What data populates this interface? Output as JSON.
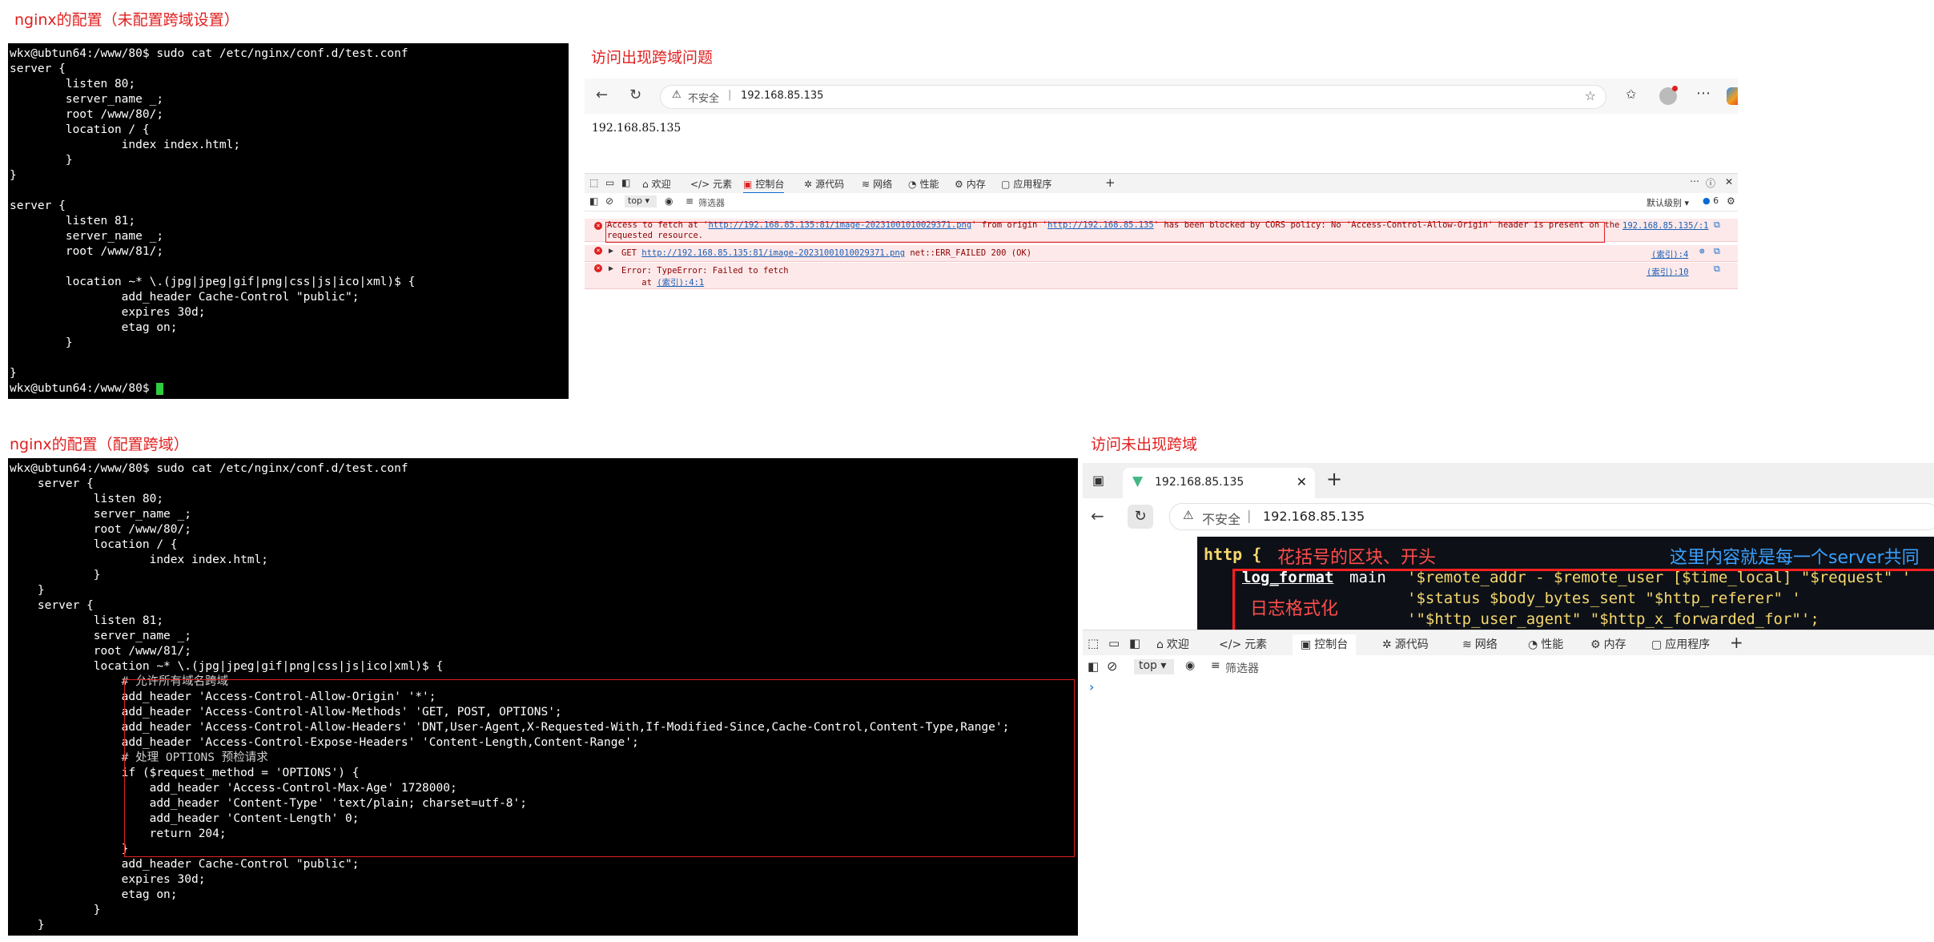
{
  "top_left": {
    "heading": "nginx的配置（未配置跨域设置）",
    "terminal_lines": [
      "wkx@ubtun64:/www/80$ sudo cat /etc/nginx/conf.d/test.conf",
      "server {",
      "        listen 80;",
      "        server_name _;",
      "        root /www/80/;",
      "        location / {",
      "                index index.html;",
      "        }",
      "}",
      "",
      "server {",
      "        listen 81;",
      "        server_name _;",
      "        root /www/81/;",
      "",
      "        location ~* \\.(jpg|jpeg|gif|png|css|js|ico|xml)$ {",
      "                add_header Cache-Control \"public\";",
      "                expires 30d;",
      "                etag on;",
      "        }",
      "",
      "}"
    ],
    "prompt": "wkx@ubtun64:/www/80$ "
  },
  "top_right": {
    "heading": "访问出现跨域问题",
    "insecure_label": "不安全",
    "separator": "|",
    "url": "192.168.85.135",
    "page_text": "192.168.85.135",
    "devtools_tabs": [
      "欢迎",
      "元素",
      "控制台",
      "源代码",
      "网络",
      "性能",
      "内存",
      "应用程序"
    ],
    "context_select": "top",
    "filter_placeholder": "筛选器",
    "level_select": "默认级别",
    "issue_count": "6",
    "errors": {
      "cors": {
        "prefix": "Access to fetch at '",
        "url1": "http://192.168.85.135:81/image-20231001010029371.png",
        "mid": "' from origin '",
        "url2": "http://192.168.85.135",
        "suffix": "' has been blocked by CORS policy: No 'Access-Control-Allow-Origin' header is present on the",
        "line2": "requested resource.",
        "source": "192.168.85.135/:1"
      },
      "get": {
        "prefix": "GET ",
        "url": "http://192.168.85.135:81/image-20231001010029371.png",
        "suffix": " net::ERR_FAILED 200 (OK)",
        "source": "(索引):4"
      },
      "type": {
        "line1": "Error: TypeError: Failed to fetch",
        "line2_prefix": "    at ",
        "line2_link": "(索引):4:1",
        "source": "(索引):10"
      }
    }
  },
  "bottom_left": {
    "heading": "nginx的配置（配置跨域）",
    "terminal_lines": [
      "wkx@ubtun64:/www/80$ sudo cat /etc/nginx/conf.d/test.conf",
      "    server {",
      "            listen 80;",
      "            server_name _;",
      "            root /www/80/;",
      "            location / {",
      "                    index index.html;",
      "            }",
      "    }",
      "    server {",
      "            listen 81;",
      "            server_name _;",
      "            root /www/81/;",
      "            location ~* \\.(jpg|jpeg|gif|png|css|js|ico|xml)$ {",
      "                # 允许所有域名跨域",
      "                add_header 'Access-Control-Allow-Origin' '*';",
      "                add_header 'Access-Control-Allow-Methods' 'GET, POST, OPTIONS';",
      "                add_header 'Access-Control-Allow-Headers' 'DNT,User-Agent,X-Requested-With,If-Modified-Since,Cache-Control,Content-Type,Range';",
      "                add_header 'Access-Control-Expose-Headers' 'Content-Length,Content-Range';",
      "                # 处理 OPTIONS 预检请求",
      "                if ($request_method = 'OPTIONS') {",
      "                    add_header 'Access-Control-Max-Age' 1728000;",
      "                    add_header 'Content-Type' 'text/plain; charset=utf-8';",
      "                    add_header 'Content-Length' 0;",
      "                    return 204;",
      "                }",
      "                add_header Cache-Control \"public\";",
      "                expires 30d;",
      "                etag on;",
      "            }",
      "    }"
    ]
  },
  "bottom_right": {
    "heading": "访问未出现跨域",
    "tab_title": "192.168.85.135",
    "insecure_label": "不安全",
    "separator": "|",
    "url": "192.168.85.135",
    "image_text": {
      "http": "http {",
      "red_note": "花括号的区块、开头",
      "blue_note": "这里内容就是每一个server共同",
      "log_format": "log_format",
      "main": "main",
      "line1": "'$remote_addr - $remote_user [$time_local] \"$request\" '",
      "note2": "日志格式化",
      "line2": "'$status $body_bytes_sent \"$http_referer\" '",
      "line3": "'\"$http_user_agent\" \"$http_x_forwarded_for\"';"
    },
    "devtools_tabs": [
      "欢迎",
      "元素",
      "控制台",
      "源代码",
      "网络",
      "性能",
      "内存",
      "应用程序"
    ],
    "context_select": "top",
    "filter_placeholder": "筛选器",
    "console_prompt": "›"
  }
}
